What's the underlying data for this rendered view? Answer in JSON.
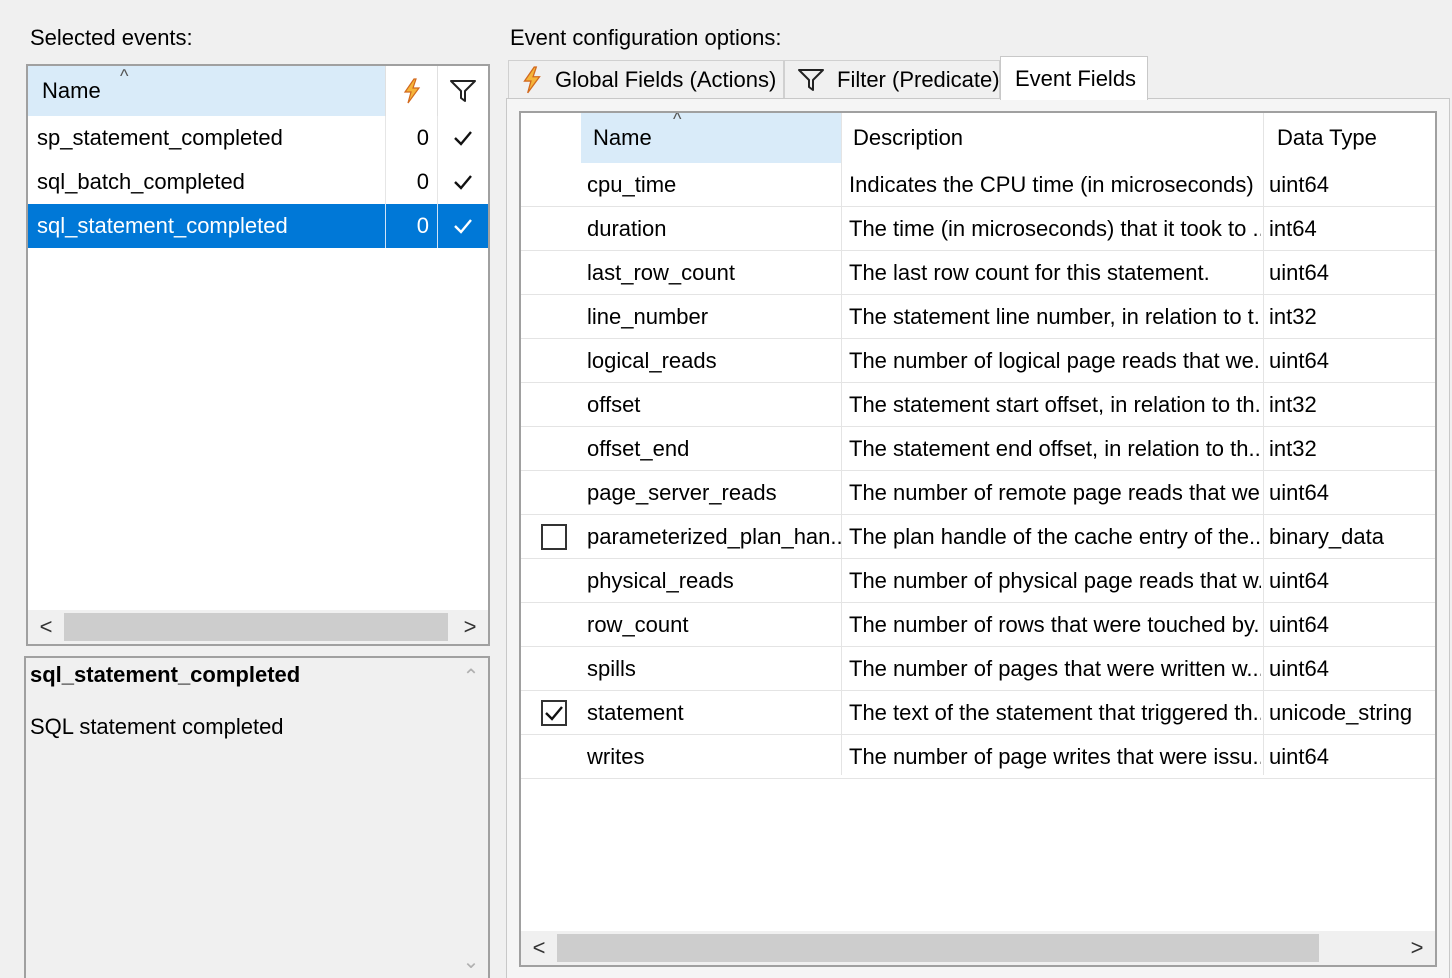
{
  "left": {
    "title": "Selected events:",
    "columns": {
      "name": "Name"
    },
    "events": [
      {
        "name": "sp_statement_completed",
        "count": "0"
      },
      {
        "name": "sql_batch_completed",
        "count": "0"
      },
      {
        "name": "sql_statement_completed",
        "count": "0"
      }
    ],
    "selected_index": 2,
    "description": {
      "title": "sql_statement_completed",
      "text": "SQL statement completed"
    }
  },
  "right": {
    "title": "Event configuration options:",
    "tabs": [
      {
        "label": "Global Fields (Actions)",
        "icon": "lightning-icon"
      },
      {
        "label": "Filter (Predicate)",
        "icon": "filter-icon"
      },
      {
        "label": "Event Fields",
        "icon": ""
      }
    ],
    "active_tab": 2,
    "columns": {
      "name": "Name",
      "description": "Description",
      "type": "Data Type"
    },
    "fields": [
      {
        "checkbox": "none",
        "name": "cpu_time",
        "description": "Indicates the CPU time (in microseconds) ...",
        "type": "uint64"
      },
      {
        "checkbox": "none",
        "name": "duration",
        "description": "The time (in microseconds) that it took to ...",
        "type": "int64"
      },
      {
        "checkbox": "none",
        "name": "last_row_count",
        "description": "The last row count for this statement.",
        "type": "uint64"
      },
      {
        "checkbox": "none",
        "name": "line_number",
        "description": "The statement line number, in relation to t...",
        "type": "int32"
      },
      {
        "checkbox": "none",
        "name": "logical_reads",
        "description": "The number of logical page reads that we...",
        "type": "uint64"
      },
      {
        "checkbox": "none",
        "name": "offset",
        "description": "The statement start offset, in relation to th...",
        "type": "int32"
      },
      {
        "checkbox": "none",
        "name": "offset_end",
        "description": "The statement end offset, in relation to th...",
        "type": "int32"
      },
      {
        "checkbox": "none",
        "name": "page_server_reads",
        "description": "The number of remote page reads that we...",
        "type": "uint64"
      },
      {
        "checkbox": "unchecked",
        "name": "parameterized_plan_han...",
        "description": "The plan handle of the cache entry of the...",
        "type": "binary_data"
      },
      {
        "checkbox": "none",
        "name": "physical_reads",
        "description": "The number of physical page reads that w...",
        "type": "uint64"
      },
      {
        "checkbox": "none",
        "name": "row_count",
        "description": "The number of rows that were touched by...",
        "type": "uint64"
      },
      {
        "checkbox": "none",
        "name": "spills",
        "description": "The number of pages that were written w...",
        "type": "uint64"
      },
      {
        "checkbox": "checked",
        "name": "statement",
        "description": "The text of the statement that triggered th...",
        "type": "unicode_string"
      },
      {
        "checkbox": "none",
        "name": "writes",
        "description": "The number of page writes that were issu...",
        "type": "uint64"
      }
    ]
  },
  "colors": {
    "selection": "#0078d7",
    "header_sorted": "#d9ebf9",
    "lightning": "#f5a623",
    "border": "#a0a0a0"
  }
}
